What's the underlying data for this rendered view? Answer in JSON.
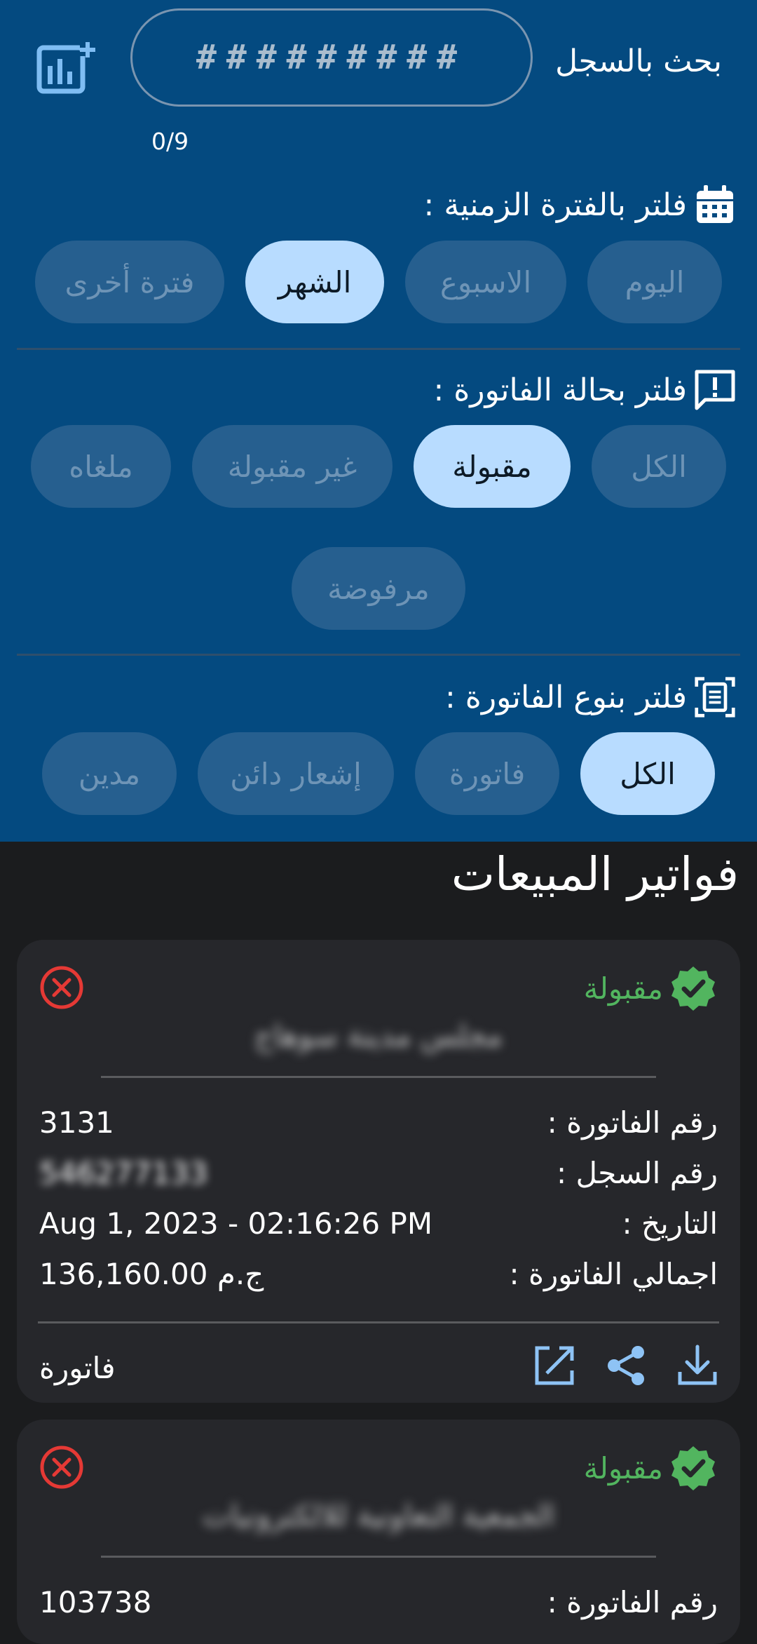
{
  "search": {
    "label": "بحث بالسجل",
    "placeholder": "#########",
    "counter": "0/9"
  },
  "icons": {
    "add_chart": "add-chart-icon",
    "calendar": "calendar-icon",
    "alert": "alert-comment-icon",
    "doc": "document-scan-icon"
  },
  "period_filter": {
    "title": "فلتر بالفترة الزمنية :",
    "options": [
      "اليوم",
      "الاسبوع",
      "الشهر",
      "فترة أخرى"
    ],
    "selected": "الشهر"
  },
  "status_filter": {
    "title": "فلتر بحالة الفاتورة :",
    "options": [
      "الكل",
      "مقبولة",
      "غير مقبولة",
      "ملغاه",
      "مرفوضة"
    ],
    "selected": "مقبولة"
  },
  "type_filter": {
    "title": "فلتر بنوع الفاتورة :",
    "options": [
      "الكل",
      "فاتورة",
      "إشعار دائن",
      "مدين"
    ],
    "selected": "الكل"
  },
  "section_title": "فواتير المبيعات",
  "colors": {
    "header_bg": "#044a80",
    "chip_active": "#b8dcff",
    "accepted": "#52b55f",
    "cancel": "#e53935",
    "action": "#8ec3f5"
  },
  "invoices": [
    {
      "status": "مقبولة",
      "customer": "مجلس مدينة سوهاج",
      "invoice_no_label": "رقم الفاتورة :",
      "invoice_no": "3131",
      "reg_no_label": "رقم السجل :",
      "reg_no": "546277133",
      "date_label": "التاريخ :",
      "date": "Aug 1, 2023 - 02:16:26 PM",
      "total_label": "اجمالي الفاتورة :",
      "total": "136,160.00  ج.م",
      "type": "فاتورة"
    },
    {
      "status": "مقبولة",
      "customer": "الجمعية التعاونية للالكترونيات",
      "invoice_no_label": "رقم الفاتورة :",
      "invoice_no": "103738"
    }
  ]
}
